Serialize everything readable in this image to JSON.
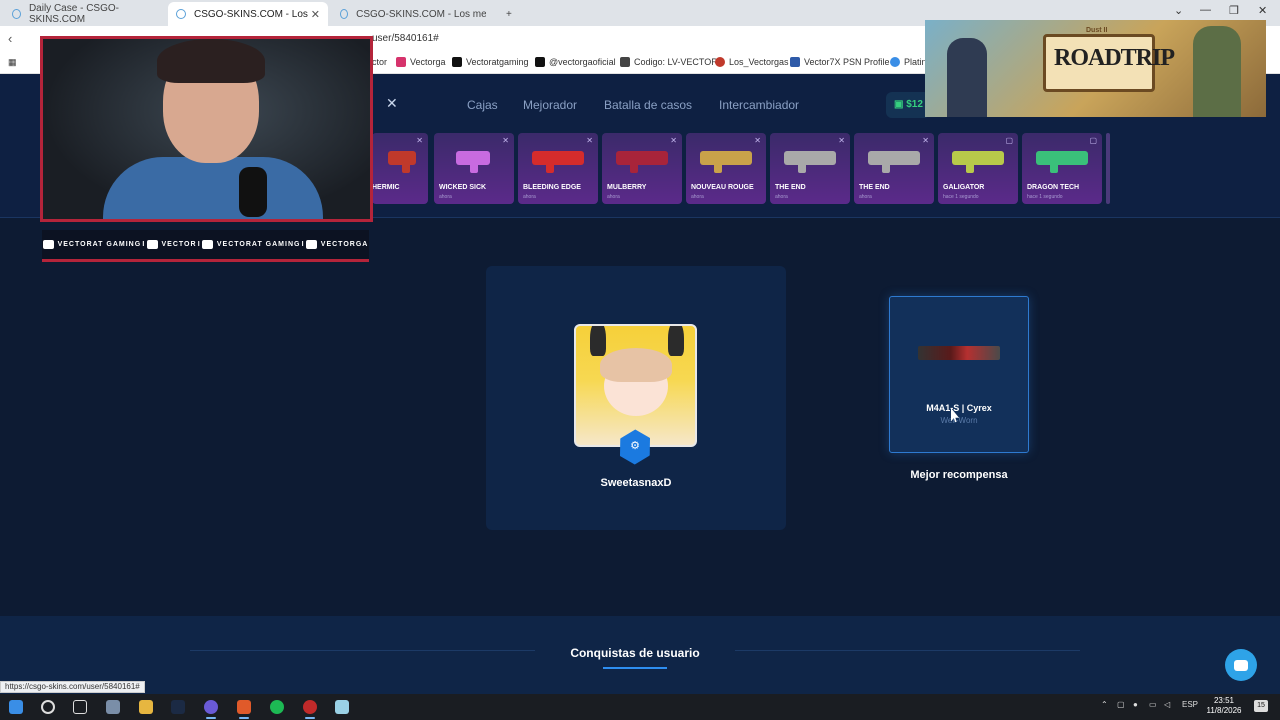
{
  "browser": {
    "tabs": [
      {
        "label": "Daily Case - CSGO-SKINS.COM",
        "active": false
      },
      {
        "label": "CSGO-SKINS.COM - Los mejores",
        "active": true
      },
      {
        "label": "CSGO-SKINS.COM - Los mejores cas",
        "active": false
      }
    ],
    "new_tab": "+",
    "url": "user/5840161#",
    "controls": {
      "minimize": "—",
      "maximize": "❐",
      "close": "✕",
      "dropdown": "⌄"
    },
    "bookmarks": [
      {
        "label": "ctor",
        "icon": "bookmark-icon",
        "color": "#888888"
      },
      {
        "label": "Vectorga",
        "icon": "instagram-icon",
        "color": "#d6336c"
      },
      {
        "label": "Vectoratgaming",
        "icon": "x-icon",
        "color": "#111111"
      },
      {
        "label": "@vectorgaoficial",
        "icon": "tiktok-icon",
        "color": "#111111"
      },
      {
        "label": "Codigo: LV-VECTOR",
        "icon": "tag-icon",
        "color": "#444444"
      },
      {
        "label": "Los_Vectorgas",
        "icon": "game-icon",
        "color": "#c0392b"
      },
      {
        "label": "Vector7X PSN Profile",
        "icon": "psn-icon",
        "color": "#2e5aa8"
      },
      {
        "label": "Platinu",
        "icon": "platinum-icon",
        "color": "#3a8ee6"
      }
    ]
  },
  "site": {
    "nav": [
      "Cajas",
      "Mejorador",
      "Batalla de casos",
      "Intercambiador"
    ],
    "balance": "$12",
    "live_drops": [
      {
        "name": "HERMIC",
        "time": "",
        "color": "#c0392b"
      },
      {
        "name": "WICKED SICK",
        "time": "ahora",
        "color": "#c86be0"
      },
      {
        "name": "BLEEDING EDGE",
        "time": "ahora",
        "color": "#d42c2c"
      },
      {
        "name": "MULBERRY",
        "time": "ahora",
        "color": "#a8243a"
      },
      {
        "name": "NOUVEAU ROUGE",
        "time": "ahora",
        "color": "#c9a24a"
      },
      {
        "name": "THE END",
        "time": "ahora",
        "color": "#a9a9a9"
      },
      {
        "name": "THE END",
        "time": "ahora",
        "color": "#a9a9a9"
      },
      {
        "name": "GALIGATOR",
        "time": "hace 1 segundo",
        "color": "#b8c94a"
      },
      {
        "name": "DRAGON TECH",
        "time": "hace 1 segundo",
        "color": "#3ac07a"
      }
    ]
  },
  "profile": {
    "username": "SweetasnaxD",
    "badge_icon": "steam-icon"
  },
  "reward": {
    "name": "M4A1-S | Cyrex",
    "wear": "Well-Worn",
    "label": "Mejor recompensa"
  },
  "achievements": {
    "title": "Conquistas de usuario"
  },
  "overlay": {
    "social": [
      {
        "icon": "youtube-icon",
        "label": "VECTORAT GAMING"
      },
      {
        "icon": "twitch-icon",
        "label": "VECTOR"
      },
      {
        "icon": "twitter-icon",
        "label": "VECTORAT GAMING"
      },
      {
        "icon": "instagram-icon",
        "label": "VECTORGA"
      }
    ],
    "separator": "I",
    "promo_title": "ROADTRIP",
    "promo_sub": "Dust II"
  },
  "status_link": "https://csgo-skins.com/user/5840161#",
  "taskbar": {
    "lang": "ESP",
    "time": "23:51",
    "date": "11/8/2026",
    "notifications": "15"
  },
  "colors": {
    "background": "#0d1b33",
    "card": "#0f2547",
    "accent": "#2e8ef0",
    "balance": "#35d07f",
    "overlay_red": "#b4243a"
  }
}
